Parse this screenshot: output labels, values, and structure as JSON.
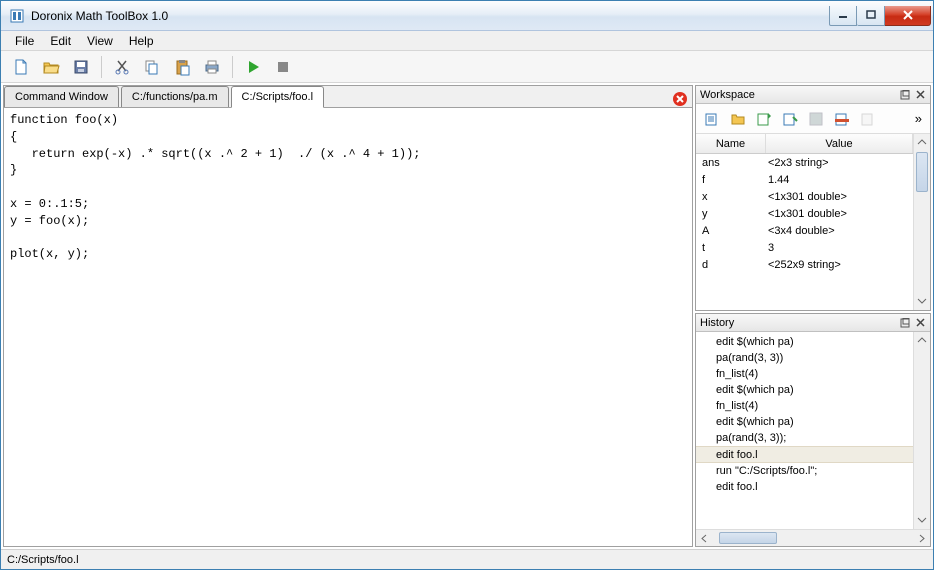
{
  "window": {
    "title": "Doronix Math ToolBox 1.0"
  },
  "menu": {
    "file": "File",
    "edit": "Edit",
    "view": "View",
    "help": "Help"
  },
  "tabs": [
    {
      "label": "Command Window",
      "active": false
    },
    {
      "label": "C:/functions/pa.m",
      "active": false
    },
    {
      "label": "C:/Scripts/foo.l",
      "active": true
    }
  ],
  "editor": {
    "text": "function foo(x)\n{\n   return exp(-x) .* sqrt((x .^ 2 + 1)  ./ (x .^ 4 + 1));\n}\n\nx = 0:.1:5;\ny = foo(x);\n\nplot(x, y);"
  },
  "workspace": {
    "title": "Workspace",
    "cols": {
      "name": "Name",
      "value": "Value"
    },
    "rows": [
      {
        "name": "ans",
        "value": "<2x3 string>"
      },
      {
        "name": "f",
        "value": "1.44"
      },
      {
        "name": "x",
        "value": "<1x301 double>"
      },
      {
        "name": "y",
        "value": "<1x301 double>"
      },
      {
        "name": "A",
        "value": "<3x4 double>"
      },
      {
        "name": "t",
        "value": "3"
      },
      {
        "name": "d",
        "value": "<252x9 string>"
      }
    ]
  },
  "history": {
    "title": "History",
    "items": [
      {
        "text": "edit $(which pa)",
        "sel": false
      },
      {
        "text": "pa(rand(3, 3))",
        "sel": false
      },
      {
        "text": "fn_list(4)",
        "sel": false
      },
      {
        "text": "edit $(which pa)",
        "sel": false
      },
      {
        "text": "fn_list(4)",
        "sel": false
      },
      {
        "text": "edit $(which pa)",
        "sel": false
      },
      {
        "text": "pa(rand(3, 3));",
        "sel": false
      },
      {
        "text": "edit foo.l",
        "sel": true
      },
      {
        "text": "run \"C:/Scripts/foo.l\";",
        "sel": false
      },
      {
        "text": "edit foo.l",
        "sel": false
      }
    ]
  },
  "status": {
    "path": "C:/Scripts/foo.l"
  }
}
